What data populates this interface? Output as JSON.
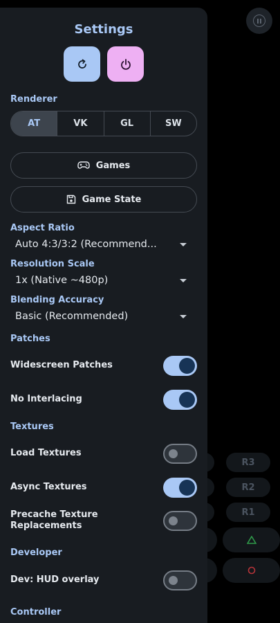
{
  "settings": {
    "title": "Settings",
    "reset_icon": "reset-icon",
    "power_icon": "power-icon",
    "renderer": {
      "label": "Renderer",
      "options": [
        "AT",
        "VK",
        "GL",
        "SW"
      ],
      "selected": "AT"
    },
    "games_button": "Games",
    "game_state_button": "Game State",
    "aspect_ratio": {
      "label": "Aspect Ratio",
      "value": "Auto 4:3/3:2 (Recommend..."
    },
    "resolution_scale": {
      "label": "Resolution Scale",
      "value": "1x (Native ~480p)"
    },
    "blending_accuracy": {
      "label": "Blending Accuracy",
      "value": "Basic (Recommended)"
    },
    "patches": {
      "label": "Patches",
      "widescreen": {
        "label": "Widescreen Patches",
        "enabled": true
      },
      "no_interlacing": {
        "label": "No Interlacing",
        "enabled": true
      }
    },
    "textures": {
      "label": "Textures",
      "load": {
        "label": "Load Textures",
        "enabled": false
      },
      "async": {
        "label": "Async Textures",
        "enabled": true
      },
      "precache": {
        "label": "Precache Texture Replacements",
        "enabled": false
      }
    },
    "developer": {
      "label": "Developer",
      "hud": {
        "label": "Dev: HUD overlay",
        "enabled": false
      }
    },
    "controller": {
      "label": "Controller"
    }
  },
  "gamepad": {
    "buttons": [
      "R3",
      "R2",
      "R1"
    ],
    "triangle_icon": "triangle-icon",
    "circle_icon": "circle-icon",
    "pause_icon": "pause-icon"
  },
  "colors": {
    "accent": "#a9c8f5",
    "power": "#eeb0f3",
    "drawer_bg": "#181c21",
    "triangle": "#2f9a4a",
    "circle": "#b8343a"
  }
}
